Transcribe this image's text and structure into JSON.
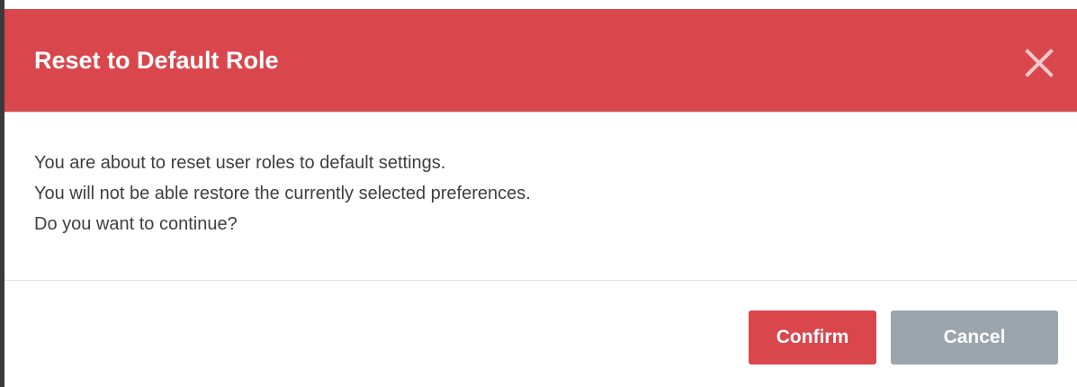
{
  "dialog": {
    "title": "Reset to Default Role",
    "close_icon": "close-icon",
    "message_lines": [
      "You are about to reset user roles to default settings.",
      "You will not be able restore the currently selected preferences.",
      "Do you want to continue?"
    ],
    "confirm_label": "Confirm",
    "cancel_label": "Cancel"
  },
  "colors": {
    "header_bg": "#d9474d",
    "confirm_bg": "#d9474d",
    "cancel_bg": "#9aa5ae",
    "body_text": "#3f3f3f"
  }
}
